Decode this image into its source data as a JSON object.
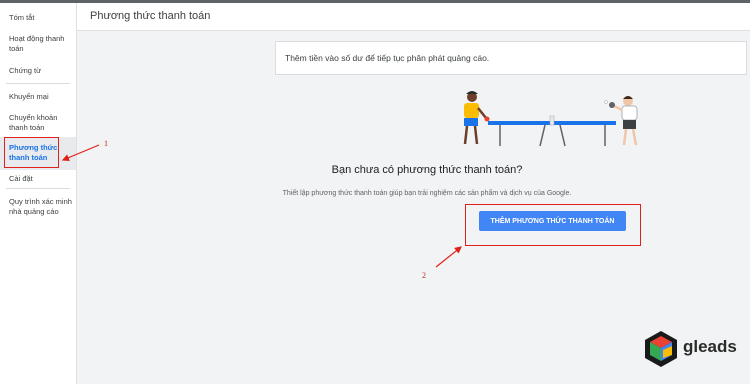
{
  "sidebar": {
    "items": [
      {
        "label": "Tóm tắt"
      },
      {
        "label": "Hoạt động thanh toán"
      },
      {
        "label": "Chứng từ"
      },
      {
        "label": "Khuyến mại"
      },
      {
        "label": "Chuyển khoản thanh toán"
      },
      {
        "label": "Phương thức thanh toán"
      },
      {
        "label": "Cài đặt"
      },
      {
        "label": "Quy trình xác minh nhà quảng cáo"
      }
    ]
  },
  "header": {
    "title": "Phương thức thanh toán"
  },
  "notice": {
    "text": "Thêm tiền vào số dư để tiếp tục phân phát quảng cáo."
  },
  "empty_state": {
    "title": "Bạn chưa có phương thức thanh toán?",
    "description": "Thiết lập phương thức thanh toán giúp bạn trải nghiệm các sản phẩm và dịch vụ của Google.",
    "button_label": "THÊM PHƯƠNG THỨC THANH TOÁN"
  },
  "annotations": {
    "step1": "1",
    "step2": "2"
  },
  "logo": {
    "text": "gleads"
  },
  "colors": {
    "accent": "#4285f4",
    "annotation": "#e0201a",
    "active_nav": "#1a73e8"
  }
}
